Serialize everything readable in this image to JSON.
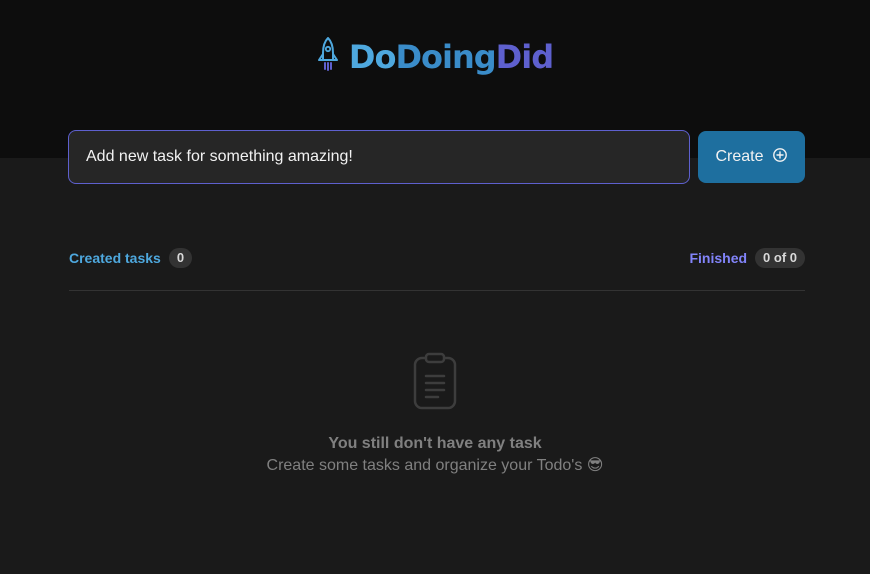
{
  "header": {
    "logo_icon": "rocket-icon",
    "title_do": "Do",
    "title_doing": "Doing",
    "title_did": "Did"
  },
  "task_input": {
    "value": "Add new task for something amazing!"
  },
  "create_button": {
    "label": "Create",
    "icon": "plus-circle-icon"
  },
  "counters": {
    "created_label": "Created tasks",
    "created_count": "0",
    "finished_label": "Finished",
    "finished_count": "0 of 0"
  },
  "empty_state": {
    "icon": "clipboard-icon",
    "title": "You still don't have any task",
    "subtitle": "Create some tasks and organize your Todo's 😎"
  },
  "colors": {
    "header_bg": "#0d0d0d",
    "body_bg": "#1a1a1a",
    "blue": "#4ea8de",
    "blue_dark": "#1e6f9f",
    "purple": "#5e60ce",
    "purple_light": "#8284fa"
  }
}
